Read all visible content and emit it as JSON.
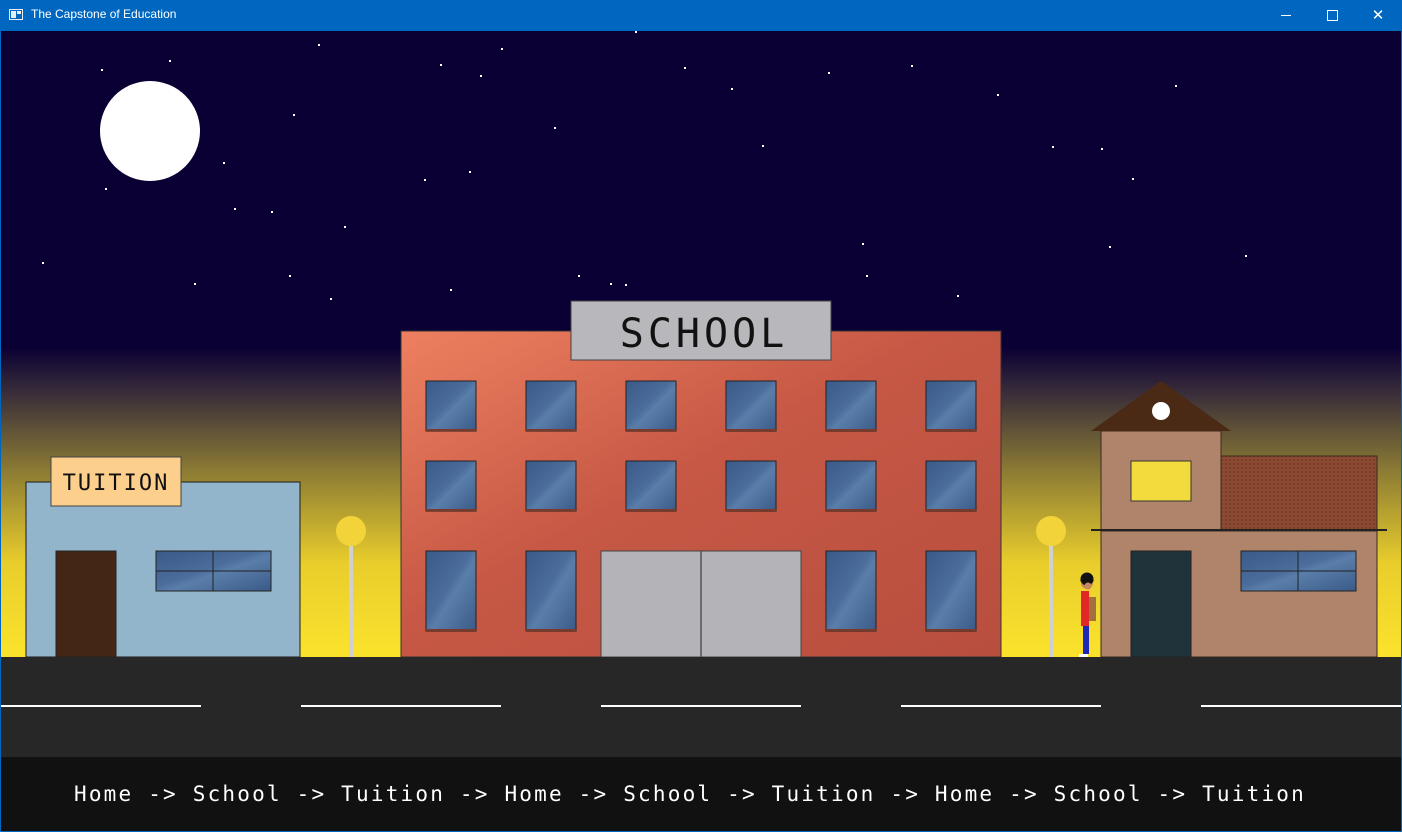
{
  "window": {
    "title": "The Capstone of Education",
    "minimize_symbol": "—",
    "maximize_symbol": "☐",
    "close_symbol": "✕"
  },
  "scene": {
    "signs": {
      "school": "SCHOOL",
      "tuition": "TUITION"
    },
    "route_text": "Home -> School -> Tuition -> Home -> School -> Tuition -> Home -> School -> Tuition",
    "colors": {
      "sky": "#0b0033",
      "glow": "#fbe32c",
      "moon": "#ffffff",
      "road": "#272727",
      "school_wall": "#c65845",
      "tuition_wall": "#92b5cb",
      "home_wall": "#b0846a",
      "window_glass": "#3e5d8c",
      "street_lamp": "#f2d43a",
      "caption_bar": "#111111"
    }
  }
}
